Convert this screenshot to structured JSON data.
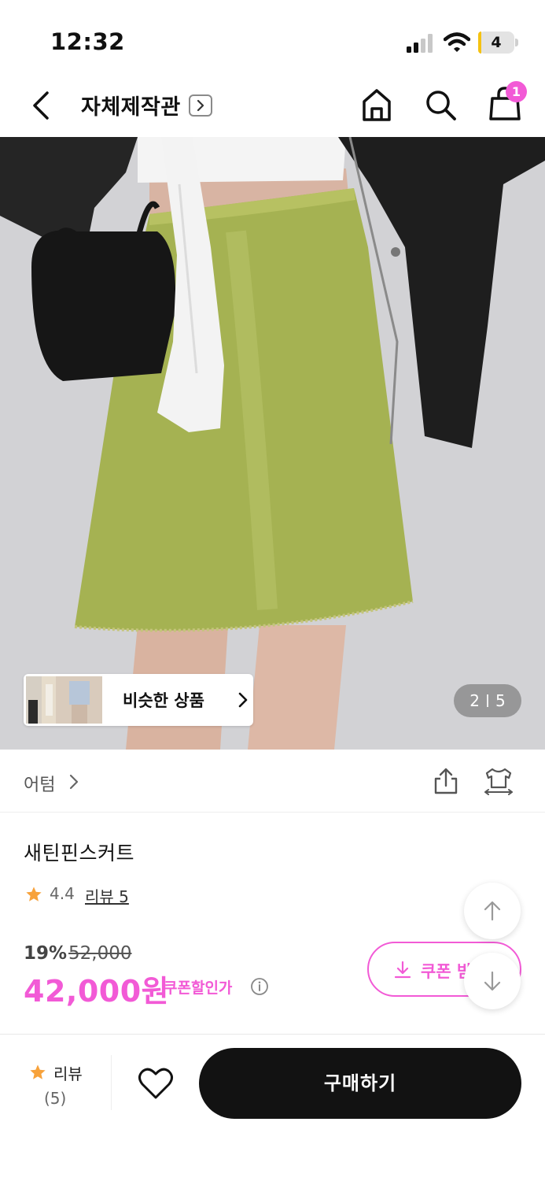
{
  "status_bar": {
    "time": "12:32",
    "battery_level": "4",
    "battery_fraction": 0.08
  },
  "nav": {
    "title": "자체제작관",
    "cart_count": "1"
  },
  "gallery": {
    "similar_label": "비슷한 상품",
    "current_index": "2",
    "total": "5"
  },
  "brand": {
    "name": "어텀"
  },
  "product": {
    "name": "새틴핀스커트",
    "rating": "4.4",
    "review_link": "리뷰 5",
    "discount_rate": "19%",
    "original_price": "52,000",
    "sale_price": "42,000원",
    "coupon_price_label": "쿠폰할인가",
    "coupon_button": "쿠폰 받"
  },
  "bottom_bar": {
    "review_label": "리뷰",
    "review_count": "(5)",
    "buy_label": "구매하기"
  },
  "colors": {
    "accent": "#f25ad6",
    "star": "#f7a23b",
    "primary_button": "#121212",
    "skirt": "#a5b252"
  }
}
